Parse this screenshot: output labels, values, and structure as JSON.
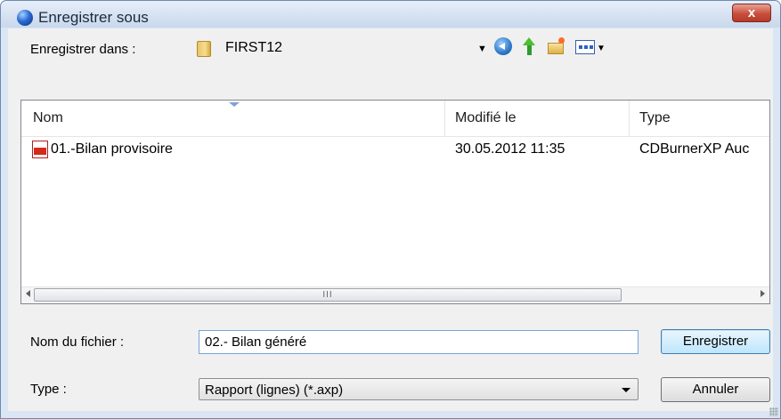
{
  "window": {
    "title": "Enregistrer sous",
    "close_label": "x"
  },
  "toolbar": {
    "save_in_label": "Enregistrer dans :",
    "current_folder": "FIRST12"
  },
  "columns": [
    {
      "label": "Nom"
    },
    {
      "label": "Modifié le"
    },
    {
      "label": "Type"
    }
  ],
  "files": [
    {
      "name": "01.-Bilan provisoire",
      "modified": "30.05.2012 11:35",
      "type": "CDBurnerXP Auc"
    }
  ],
  "scrollbar": {
    "thumb_label": "III"
  },
  "filename": {
    "label": "Nom du fichier :",
    "value": "02.- Bilan généré"
  },
  "filetype": {
    "label": "Type :",
    "value": "Rapport (lignes) (*.axp)"
  },
  "buttons": {
    "save": "Enregistrer",
    "cancel": "Annuler"
  },
  "colors": {
    "close_button": "#c94f3c",
    "title_bar": "#d3e0f1",
    "input_border": "#7aa4d6"
  }
}
